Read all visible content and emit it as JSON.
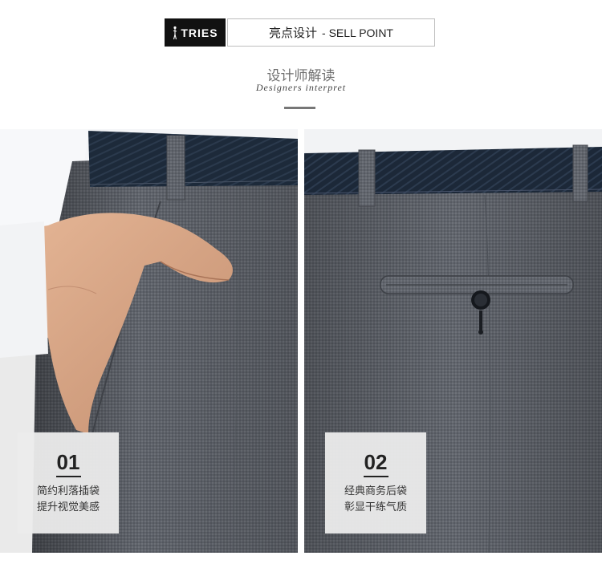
{
  "header": {
    "brand": "TRIES",
    "title_cn": "亮点设计",
    "title_en": "- SELL POINT"
  },
  "section": {
    "title_cn": "设计师解读",
    "title_en": "Designers interpret"
  },
  "features": [
    {
      "number": "01",
      "line1": "简约利落插袋",
      "line2": "提升视觉美感"
    },
    {
      "number": "02",
      "line1": "经典商务后袋",
      "line2": "彰显干练气质"
    }
  ],
  "colors": {
    "trouser": "#5f636b",
    "belt": "#1d2a3a",
    "shirt": "#f4f5f7",
    "skin": "#d9a585"
  }
}
